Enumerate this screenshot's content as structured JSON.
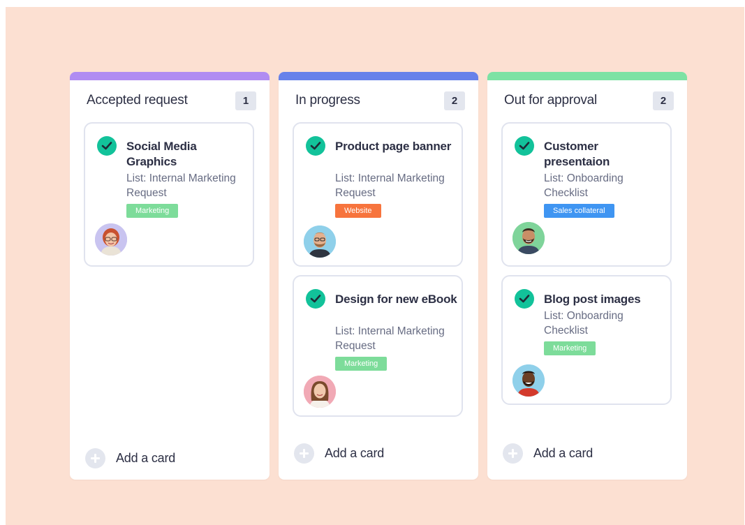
{
  "board": {
    "background_color": "#fce0d2",
    "columns": [
      {
        "title": "Accepted request",
        "count": "1",
        "accent_color": "#b08cf2",
        "cards": [
          {
            "title": "Social Media Graphics",
            "list": "List: Internal Marketing Request",
            "tag": {
              "label": "Marketing",
              "color": "#7ddc9a"
            },
            "avatar": "avatar-woman-red-hair-glasses"
          }
        ],
        "add_label": "Add a card"
      },
      {
        "title": "In progress",
        "count": "2",
        "accent_color": "#6781ea",
        "cards": [
          {
            "title": "Product page banner",
            "list": "List: Internal Marketing Request",
            "tag": {
              "label": "Website",
              "color": "#f7743d"
            },
            "avatar": "avatar-man-glasses-beard"
          },
          {
            "title": "Design for new eBook",
            "list": "List: Internal Marketing Request",
            "tag": {
              "label": "Marketing",
              "color": "#7ddc9a"
            },
            "avatar": "avatar-woman-long-hair"
          }
        ],
        "add_label": "Add a card"
      },
      {
        "title": "Out for approval",
        "count": "2",
        "accent_color": "#7de2a4",
        "cards": [
          {
            "title": "Customer presentaion",
            "list": "List: Onboarding Checklist",
            "tag": {
              "label": "Sales collateral",
              "color": "#3f95f2"
            },
            "avatar": "avatar-man-beard"
          },
          {
            "title": "Blog post images",
            "list": "List: Onboarding Checklist",
            "tag": {
              "label": "Marketing",
              "color": "#7ddc9a"
            },
            "avatar": "avatar-man-smiling"
          }
        ],
        "add_label": "Add a card"
      }
    ],
    "icons": {
      "check": "check-circle-icon",
      "add": "plus-circle-icon"
    }
  }
}
